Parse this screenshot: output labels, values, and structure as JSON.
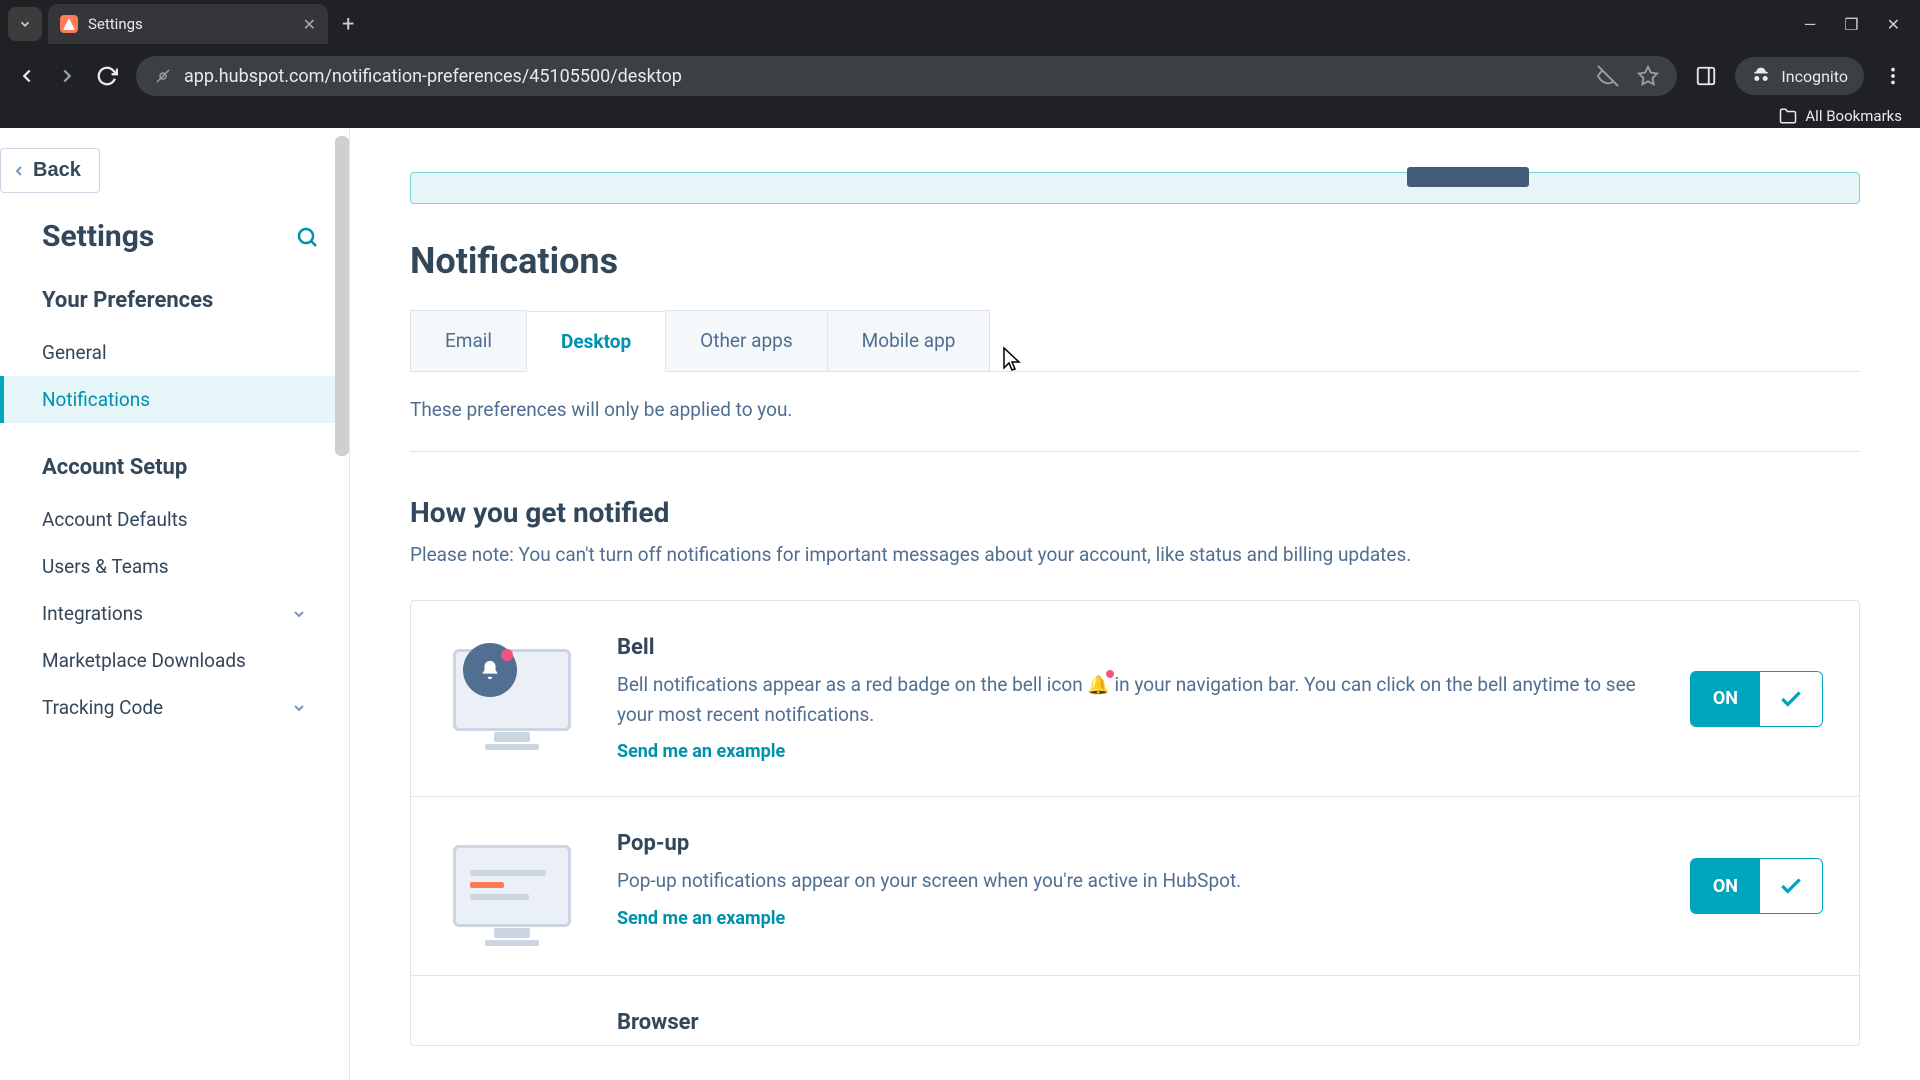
{
  "browser": {
    "tab_title": "Settings",
    "url": "app.hubspot.com/notification-preferences/45105500/desktop",
    "incognito_label": "Incognito",
    "all_bookmarks": "All Bookmarks"
  },
  "sidebar": {
    "back": "Back",
    "title": "Settings",
    "section_prefs": "Your Preferences",
    "section_account": "Account Setup",
    "items_prefs": [
      {
        "label": "General"
      },
      {
        "label": "Notifications"
      }
    ],
    "items_account": [
      {
        "label": "Account Defaults"
      },
      {
        "label": "Users & Teams"
      },
      {
        "label": "Integrations"
      },
      {
        "label": "Marketplace Downloads"
      },
      {
        "label": "Tracking Code"
      }
    ]
  },
  "page": {
    "title": "Notifications",
    "tabs": [
      "Email",
      "Desktop",
      "Other apps",
      "Mobile app"
    ],
    "hint": "These preferences will only be applied to you.",
    "section": "How you get notified",
    "note": "Please note: You can't turn off notifications for important messages about your account, like status and billing updates.",
    "toggle_on": "ON",
    "example": "Send me an example",
    "cards": {
      "bell": {
        "title": "Bell",
        "desc_a": "Bell notifications appear as a red badge on the bell icon ",
        "desc_b": " in your navigation bar. You can click on the bell anytime to see your most recent notifications."
      },
      "popup": {
        "title": "Pop-up",
        "desc": "Pop-up notifications appear on your screen when you're active in HubSpot."
      },
      "browser": {
        "title": "Browser"
      }
    }
  }
}
